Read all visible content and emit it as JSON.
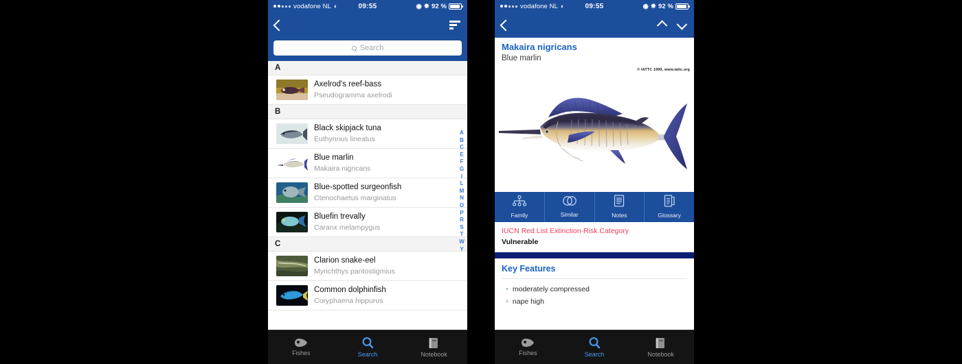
{
  "statusbar": {
    "carrier": "vodafone NL",
    "time": "09:55",
    "battery": "92 %"
  },
  "left_phone": {
    "nav": {
      "back_icon": "back-chevron-icon",
      "sort_icon": "sort-icon"
    },
    "search": {
      "placeholder": "Search",
      "value": ""
    },
    "sections": [
      {
        "letter": "A",
        "items": [
          {
            "common": "Axelrod's reef-bass",
            "latin": "Pseudogramma axelrodi",
            "thumb": "reef-bass-photo"
          }
        ]
      },
      {
        "letter": "B",
        "items": [
          {
            "common": "Black skipjack tuna",
            "latin": "Euthynnus lineatus",
            "thumb": "skipjack-tuna-photo"
          },
          {
            "common": "Blue marlin",
            "latin": "Makaira nigricans",
            "thumb": "blue-marlin-photo"
          },
          {
            "common": "Blue-spotted surgeonfish",
            "latin": "Ctenochaetus marginatus",
            "thumb": "surgeonfish-photo"
          },
          {
            "common": "Bluefin trevally",
            "latin": "Caranx melampygus",
            "thumb": "trevally-photo"
          }
        ]
      },
      {
        "letter": "C",
        "items": [
          {
            "common": "Clarion snake-eel",
            "latin": "Myrichthys pantostigmius",
            "thumb": "snake-eel-photo"
          },
          {
            "common": "Common dolphinfish",
            "latin": "Coryphaena hippurus",
            "thumb": "dolphinfish-photo"
          }
        ]
      }
    ],
    "index_letters": [
      "A",
      "B",
      "C",
      "E",
      "F",
      "G",
      "I",
      "L",
      "M",
      "N",
      "O",
      "P",
      "R",
      "S",
      "T",
      "W",
      "Y"
    ]
  },
  "right_phone": {
    "nav": {
      "back_icon": "back-chevron-icon",
      "prev_icon": "chevron-up-icon",
      "next_icon": "chevron-down-icon"
    },
    "species": {
      "scientific_name": "Makaira nigricans",
      "common_name": "Blue marlin",
      "image_credit": "© IATTC 1999, www.iattc.org"
    },
    "tabs": [
      {
        "label": "Family",
        "icon": "family-tree-icon"
      },
      {
        "label": "Similar",
        "icon": "venn-circles-icon"
      },
      {
        "label": "Notes",
        "icon": "notes-document-icon"
      },
      {
        "label": "Glossary",
        "icon": "glossary-book-icon"
      }
    ],
    "iucn": {
      "title": "IUCN Red List Extinction-Risk Category",
      "value": "Vulnerable"
    },
    "key_features": {
      "title": "Key Features",
      "items": [
        "moderately compressed",
        "nape high"
      ]
    }
  },
  "tabbar": {
    "items": [
      {
        "label": "Fishes",
        "icon": "fish-icon",
        "active": false
      },
      {
        "label": "Search",
        "icon": "search-icon",
        "active": true
      },
      {
        "label": "Notebook",
        "icon": "notebook-icon",
        "active": false
      }
    ]
  },
  "colors": {
    "header_blue": "#1d4e9c",
    "navy": "#0b1f72",
    "accent_link": "#1a63c4",
    "index_blue": "#3a7bd5",
    "iucn_red": "#ef3b5b",
    "tabbar_bg": "#141414",
    "tab_active": "#4a9bf5"
  }
}
